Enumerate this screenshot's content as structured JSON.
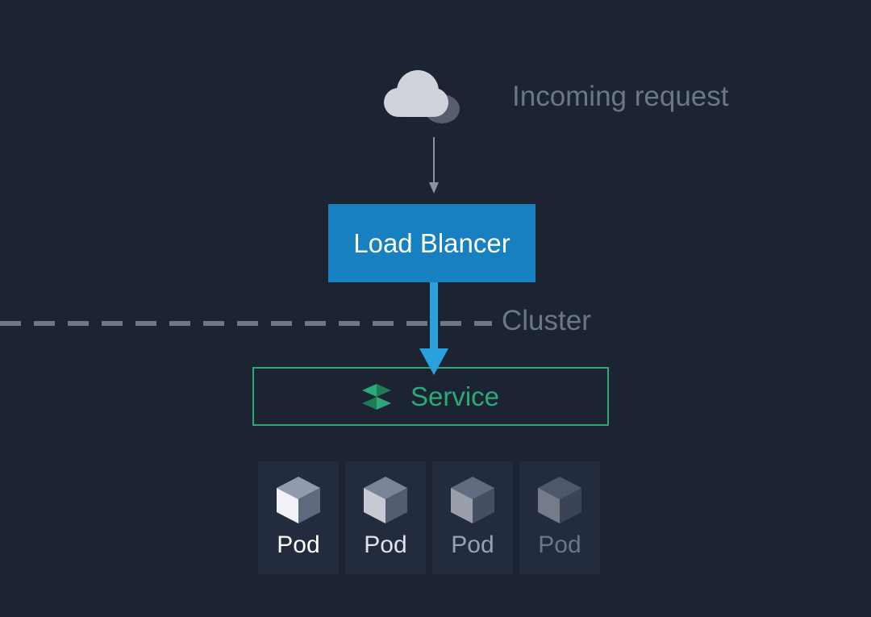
{
  "labels": {
    "incoming": "Incoming request",
    "load_balancer": "Load Blancer",
    "cluster": "Cluster",
    "service": "Service"
  },
  "pods": [
    {
      "label": "Pod",
      "opacity": 1.0,
      "label_color": "#ffffff"
    },
    {
      "label": "Pod",
      "opacity": 0.8,
      "label_color": "#dfe2e8"
    },
    {
      "label": "Pod",
      "opacity": 0.58,
      "label_color": "#9aa2b0"
    },
    {
      "label": "Pod",
      "opacity": 0.4,
      "label_color": "#6b7786"
    }
  ],
  "colors": {
    "bg": "#1c2434",
    "muted": "#6b7786",
    "lb": "#1680c0",
    "service": "#29aa77",
    "cloud_light": "#d0d3da",
    "cloud_dark": "#555d6e",
    "arrow_blue": "#28a1dc"
  }
}
